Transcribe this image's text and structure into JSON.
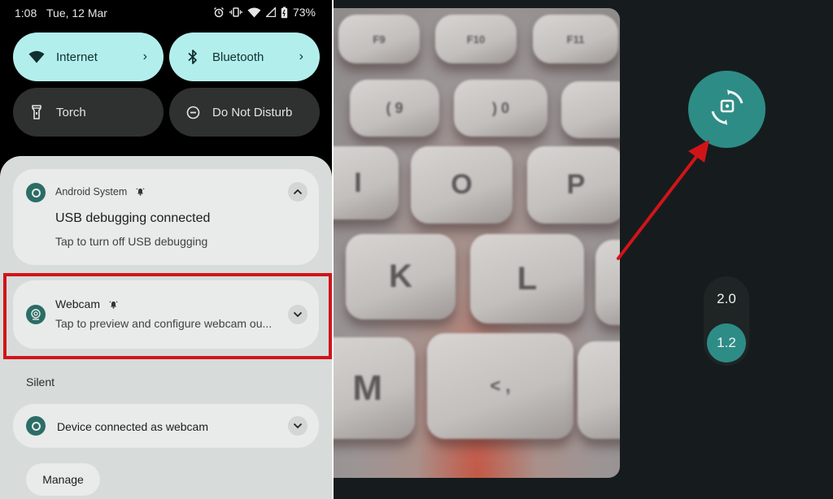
{
  "status_bar": {
    "time": "1:08",
    "date": "Tue, 12 Mar",
    "icons": [
      "alarm-icon",
      "vibrate-icon",
      "wifi-icon",
      "cell-signal-icon",
      "battery-charging-icon"
    ],
    "battery_percent": "73%"
  },
  "quick_settings": {
    "tiles": [
      {
        "label": "Internet",
        "icon": "wifi-icon",
        "state": "on",
        "has_chevron": true,
        "chevron": "›"
      },
      {
        "label": "Bluetooth",
        "icon": "bluetooth-icon",
        "state": "on",
        "has_chevron": true,
        "chevron": "›"
      },
      {
        "label": "Torch",
        "icon": "flashlight-icon",
        "state": "off",
        "has_chevron": false
      },
      {
        "label": "Do Not Disturb",
        "icon": "do-not-disturb-icon",
        "state": "off",
        "has_chevron": false
      }
    ]
  },
  "notifications": [
    {
      "app": "Android System",
      "title": "USB debugging connected",
      "text": "Tap to turn off USB debugging",
      "expanded": true,
      "alerting": true
    },
    {
      "app": "Webcam",
      "text": "Tap to preview and configure webcam ou...",
      "expanded": false,
      "alerting": true,
      "highlighted": true
    }
  ],
  "silent_section": {
    "label": "Silent",
    "notifications": [
      {
        "title": "Device connected as webcam",
        "expanded": false
      }
    ]
  },
  "manage_button": "Manage",
  "webcam_preview": {
    "feed_key_labels": [
      "F9",
      "F10",
      "F11",
      "( 9",
      ") 0",
      "I",
      "O",
      "P",
      "K",
      "L",
      "M",
      "< ,"
    ],
    "switch_camera_icon": "switch-camera-icon",
    "zoom_options": [
      "2.0",
      "1.2"
    ],
    "zoom_selected": "1.2"
  },
  "colors": {
    "accent_teal": "#2e8c86",
    "tile_on": "#b2efec",
    "tile_off": "#2f3131",
    "annotation_red": "#d1141a",
    "preview_bg": "#161c1d",
    "sheet_bg": "#d7dbd9",
    "card_bg": "#e8ebe9"
  }
}
